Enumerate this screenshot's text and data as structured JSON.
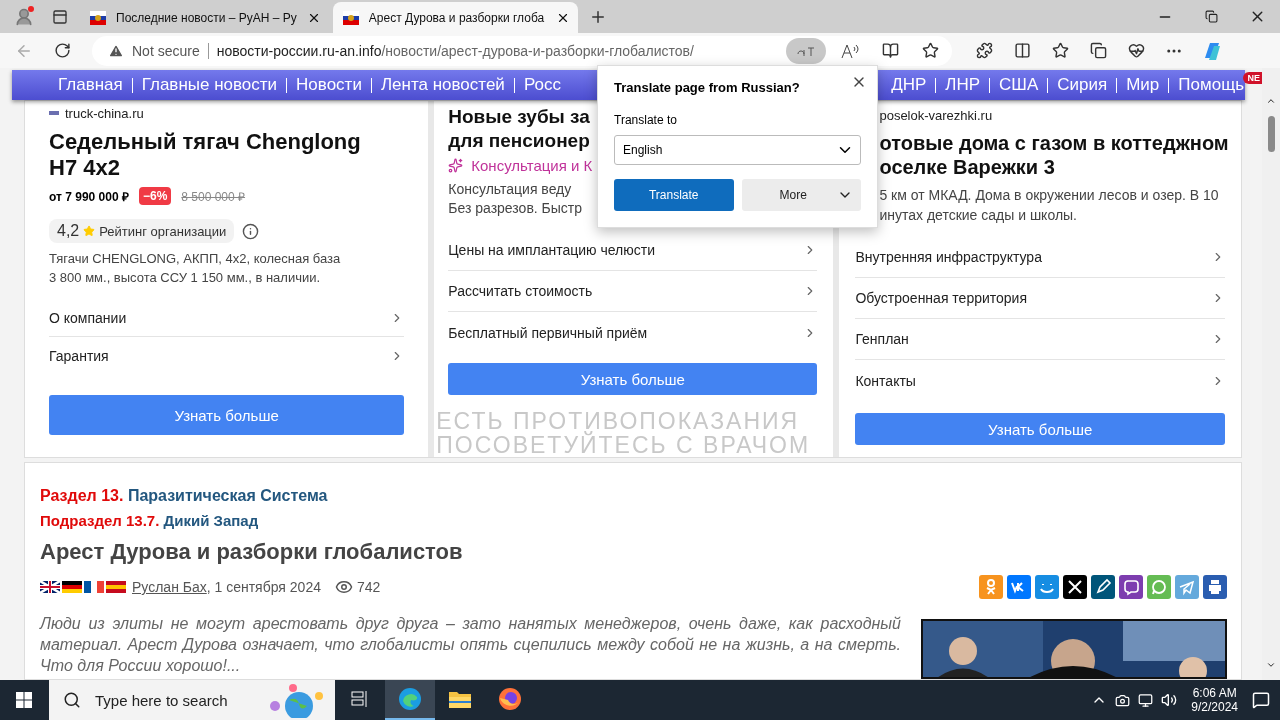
{
  "browser": {
    "tabs": [
      {
        "title": "Последние новости – РуАН – Ру",
        "selected": false
      },
      {
        "title": "Арест Дурова и разборки глоба",
        "selected": true
      }
    ],
    "address": {
      "security": "Not secure",
      "host": "новости-россии.ru-an.info",
      "path": "/новости/арест-дурова-и-разборки-глобалистов/"
    }
  },
  "nav": {
    "left": [
      "Главная",
      "Главные новости",
      "Новости",
      "Лента новостей",
      "Росс"
    ],
    "right": [
      "ДНР",
      "ЛНР",
      "США",
      "Сирия",
      "Мир",
      "Помощь"
    ],
    "badge": "NE"
  },
  "ads": [
    {
      "kind": "product",
      "domain": "truck-china.ru",
      "title": [
        "Седельный тягач Chenglong",
        "H7 4x2"
      ],
      "price": "от 7 990 000 ₽",
      "discount": "−6%",
      "old_price": "8 500 000 ₽",
      "rating": "4,2",
      "rating_label": "Рейтинг организации",
      "description": [
        "Тягачи CHENGLONG, АКПП, 4x2, колесная база",
        "3 800 мм., высота ССУ 1 150 мм., в наличии."
      ],
      "links": [
        "О компании",
        "Гарантия"
      ],
      "button": "Узнать больше"
    },
    {
      "kind": "service",
      "title": [
        "Новые зубы за",
        "для пенсионер"
      ],
      "tagline": "Консультация и К",
      "description": [
        "Консультация веду",
        "Без разрезов. Быстр"
      ],
      "links": [
        "Цены на имплантацию челюсти",
        "Рассчитать стоимость",
        "Бесплатный первичный приём"
      ],
      "button": "Узнать больше",
      "warning": [
        "ЕСТЬ ПРОТИВОПОКАЗАНИЯ",
        "ПОСОВЕТУЙТЕСЬ С ВРАЧОМ"
      ]
    },
    {
      "kind": "realty",
      "domain": "poselok-varezhki.ru",
      "title": [
        "отовые дома с газом в коттеджном",
        "оселке Варежки 3"
      ],
      "description": [
        "5 км от МКАД. Дома в окружении лесов и озер. В 10",
        "инутах детские сады и школы."
      ],
      "links": [
        "Внутренняя инфраструктура",
        "Обустроенная территория",
        "Генплан",
        "Контакты"
      ],
      "button": "Узнать больше"
    }
  ],
  "article": {
    "section_label": "Раздел 13.",
    "section": "Паразитическая Система",
    "subsection_label": "Подраздел 13.7.",
    "subsection": "Дикий Запад",
    "title": "Арест Дурова и разборки глобалистов",
    "flags": [
      {
        "kind": "uk"
      },
      {
        "kind": "de"
      },
      {
        "kind": "fr"
      },
      {
        "kind": "es"
      }
    ],
    "author": "Руслан Бах",
    "date": ", 1 сентября 2024",
    "views": "742",
    "share": [
      {
        "kind": "ok",
        "color": "#f7931e"
      },
      {
        "kind": "vk",
        "color": "#0077ff"
      },
      {
        "kind": "mail",
        "color": "#168de2"
      },
      {
        "kind": "x",
        "color": "#000000"
      },
      {
        "kind": "pen",
        "color": "#00557a"
      },
      {
        "kind": "viber",
        "color": "#7d3daf"
      },
      {
        "kind": "whatsapp",
        "color": "#65bc54"
      },
      {
        "kind": "telegram",
        "color": "#64a9dc"
      },
      {
        "kind": "print",
        "color": "#2a5db0"
      }
    ],
    "lead": "Люди из элиты не могут арестовать друг друга – зато нанятых менеджеров, очень даже, как расходный материал. Арест Дурова означает, что глобалисты опять сцепились между собой не на жизнь, а на смерть. Что для России хорошо!..."
  },
  "translate": {
    "title": "Translate page from Russian?",
    "label": "Translate to",
    "language": "English",
    "primary": "Translate",
    "secondary": "More"
  },
  "taskbar": {
    "search": "Type here to search",
    "apps": [
      {
        "kind": "taskview",
        "selected": false
      },
      {
        "kind": "edge",
        "selected": true
      },
      {
        "kind": "explorer",
        "selected": false
      },
      {
        "kind": "firefox",
        "selected": false
      }
    ],
    "time": "6:06 AM",
    "date": "9/2/2024"
  }
}
